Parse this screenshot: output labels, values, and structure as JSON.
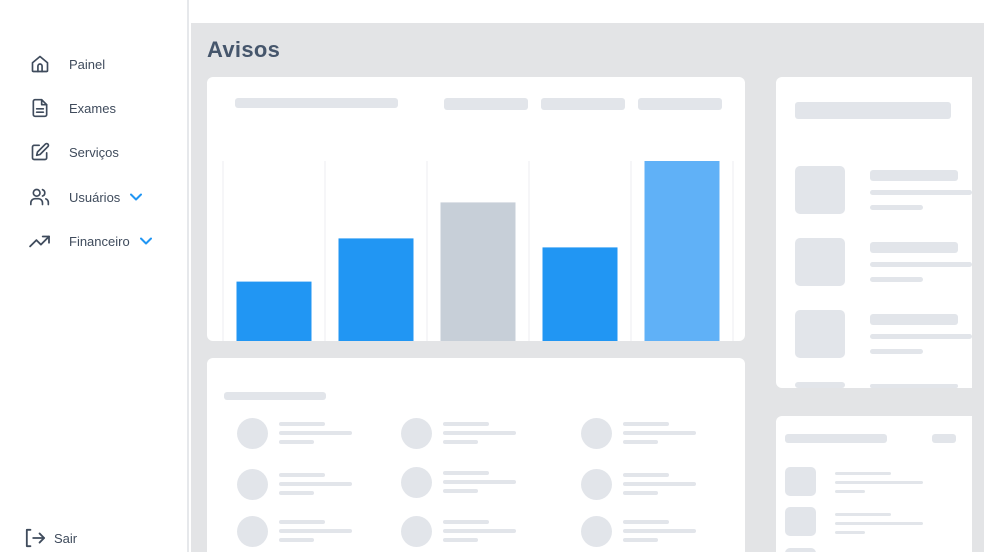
{
  "sidebar": {
    "items": [
      {
        "label": "Painel",
        "icon": "home-icon"
      },
      {
        "label": "Exames",
        "icon": "document-icon"
      },
      {
        "label": "Serviços",
        "icon": "edit-icon"
      },
      {
        "label": "Usuários",
        "icon": "users-icon",
        "expandable": true
      },
      {
        "label": "Financeiro",
        "icon": "trending-up-icon",
        "expandable": true
      }
    ],
    "logout_label": "Sair"
  },
  "main": {
    "title": "Avisos"
  },
  "colors": {
    "bar_blue": "#2196f3",
    "bar_gray": "#c7cfd8",
    "bar_light_blue": "#60b1f7",
    "skeleton": "#e2e5ea",
    "accent": "#2196f3"
  },
  "chart_data": {
    "type": "bar",
    "categories": [
      "",
      "",
      "",
      "",
      ""
    ],
    "values": [
      33,
      57,
      77,
      52,
      100
    ],
    "colors": [
      "#2196f3",
      "#2196f3",
      "#c7cfd8",
      "#2196f3",
      "#60b1f7"
    ],
    "ylim": [
      0,
      100
    ],
    "grid": true
  }
}
